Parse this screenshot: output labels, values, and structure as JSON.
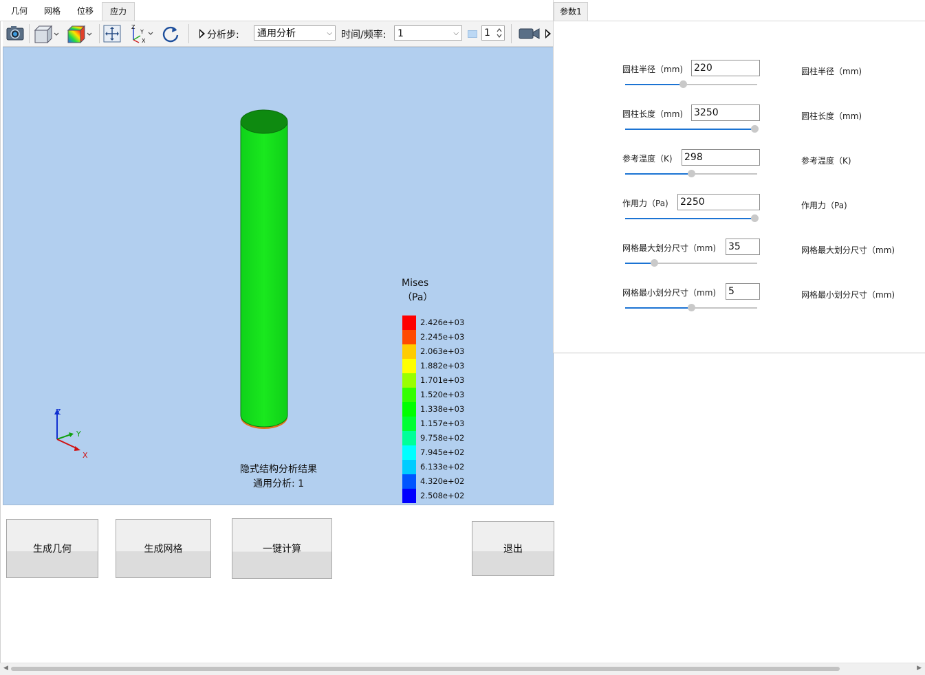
{
  "menu_tabs": [
    {
      "label": "几何"
    },
    {
      "label": "网格"
    },
    {
      "label": "位移"
    },
    {
      "label": "应力"
    }
  ],
  "active_tab": "应力",
  "toolbar": {
    "analysis_step_label": "分析步:",
    "analysis_step_value": "通用分析",
    "time_freq_label": "时间/频率:",
    "time_freq_value": "1",
    "frame_value": "1"
  },
  "viewport": {
    "background_color": "#b2cfef",
    "result_title": "隐式结构分析结果",
    "result_subtitle": "通用分析: 1",
    "axis_z": "Z",
    "axis_y": "Y",
    "axis_x": "X",
    "legend": {
      "title": "Mises",
      "unit": "（Pa）",
      "entries": [
        {
          "value": "2.426e+03",
          "color": "#ff0000"
        },
        {
          "value": "2.245e+03",
          "color": "#ff4a00"
        },
        {
          "value": "2.063e+03",
          "color": "#ffcc00"
        },
        {
          "value": "1.882e+03",
          "color": "#ffff00"
        },
        {
          "value": "1.701e+03",
          "color": "#99ff00"
        },
        {
          "value": "1.520e+03",
          "color": "#33ff00"
        },
        {
          "value": "1.338e+03",
          "color": "#00ff00"
        },
        {
          "value": "1.157e+03",
          "color": "#00ff33"
        },
        {
          "value": "9.758e+02",
          "color": "#00ff99"
        },
        {
          "value": "7.945e+02",
          "color": "#00ffff"
        },
        {
          "value": "6.133e+02",
          "color": "#00ccff"
        },
        {
          "value": "4.320e+02",
          "color": "#0055ff"
        },
        {
          "value": "2.508e+02",
          "color": "#0000ff"
        }
      ]
    }
  },
  "buttons": {
    "generate_geometry": "生成几何",
    "generate_mesh": "生成网格",
    "one_click_compute": "一键计算",
    "exit": "退出"
  },
  "panel": {
    "tab_label": "参数1",
    "params": [
      {
        "label": "圆柱半径（mm)",
        "value": "220",
        "desc": "圆柱半径（mm)",
        "slider_fraction": 0.44
      },
      {
        "label": "圆柱长度（mm)",
        "value": "3250",
        "desc": "圆柱长度（mm)",
        "slider_fraction": 0.98
      },
      {
        "label": "参考温度（K)",
        "value": "298",
        "desc": "参考温度（K)",
        "slider_fraction": 0.5
      },
      {
        "label": "作用力（Pa)",
        "value": "2250",
        "desc": "作用力（Pa)",
        "slider_fraction": 0.98
      },
      {
        "label": "网格最大划分尺寸（mm)",
        "value": "35",
        "desc": "网格最大划分尺寸（mm)",
        "slider_fraction": 0.22
      },
      {
        "label": "网格最小划分尺寸（mm)",
        "value": "5",
        "desc": "网格最小划分尺寸（mm)",
        "slider_fraction": 0.5
      }
    ]
  }
}
